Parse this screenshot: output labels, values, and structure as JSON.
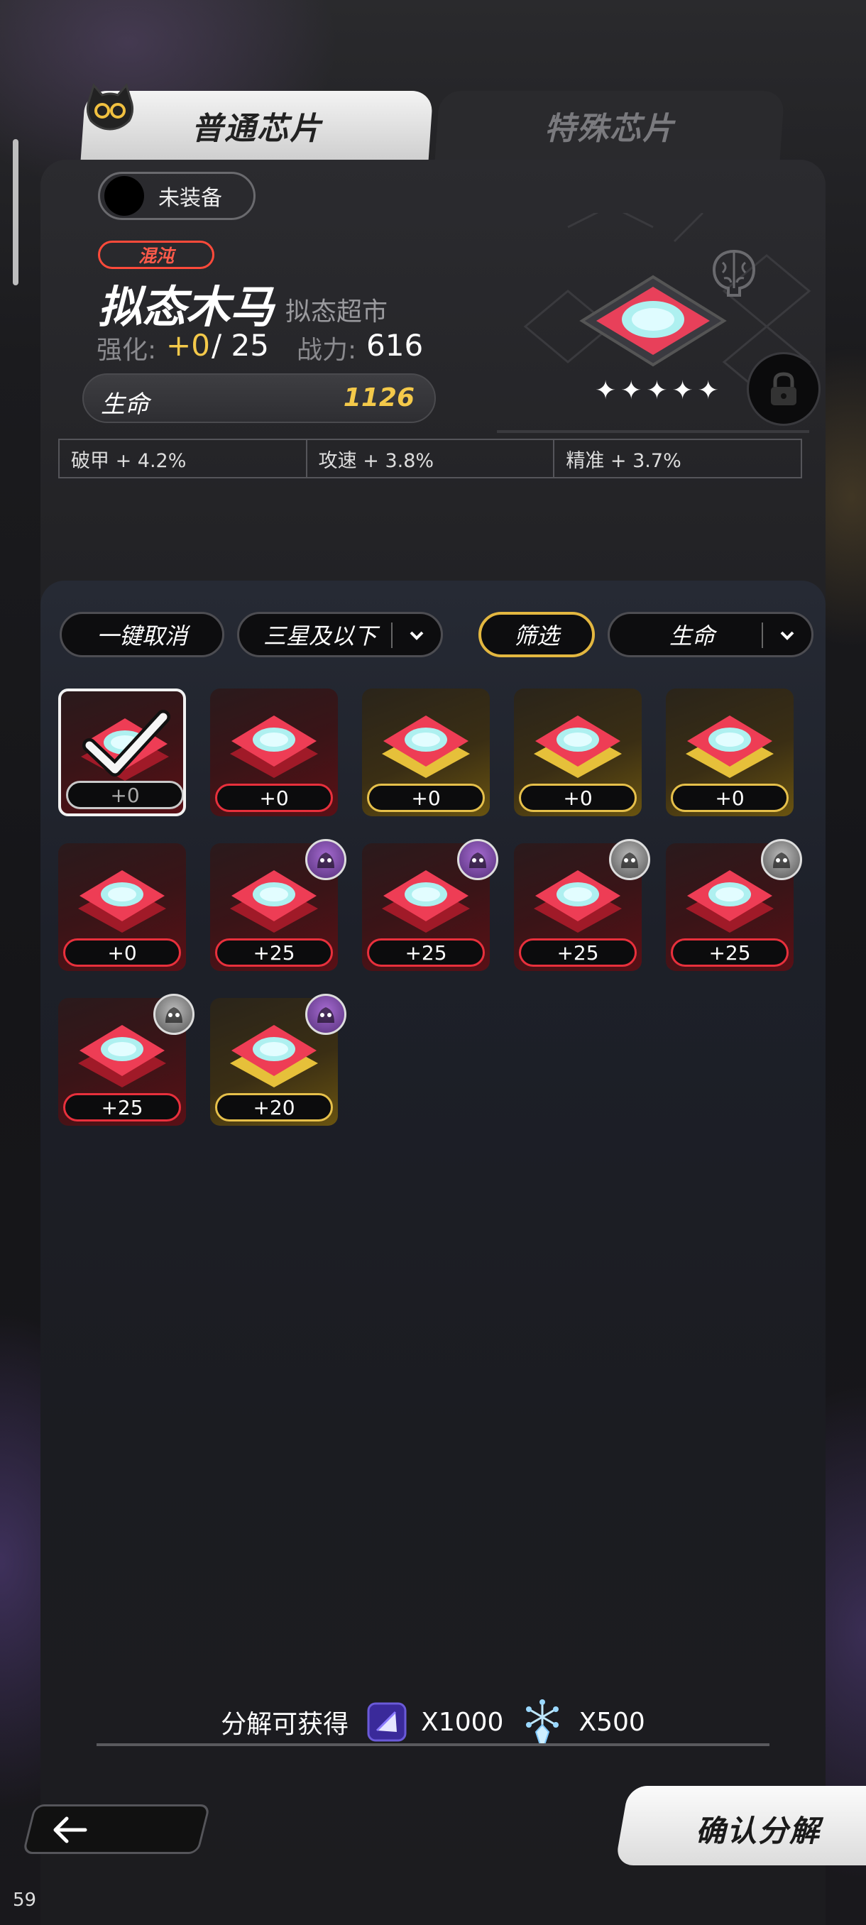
{
  "tabs": {
    "normal": "普通芯片",
    "special": "特殊芯片"
  },
  "equip_status": "未装备",
  "chip": {
    "tag": "混沌",
    "name": "拟态木马",
    "set": "拟态超市",
    "enhance_label": "强化:",
    "enhance_value": "+0",
    "enhance_max": "/ 25",
    "power_label": "战力:",
    "power_value": "616",
    "main_stat_label": "生命",
    "main_stat_value": "1126",
    "stars": "✦✦✦✦✦",
    "star_count": 5,
    "sub_stats": [
      "破甲 + 4.2%",
      "攻速 + 3.8%",
      "精准 + 3.7%"
    ]
  },
  "controls": {
    "cancel_all": "一键取消",
    "star_filter": "三星及以下",
    "filter": "筛选",
    "sort": "生命"
  },
  "chips": [
    {
      "level": "+0",
      "rarity": "red",
      "selected": true,
      "owner": null
    },
    {
      "level": "+0",
      "rarity": "red",
      "selected": false,
      "owner": null
    },
    {
      "level": "+0",
      "rarity": "gold",
      "selected": false,
      "owner": null
    },
    {
      "level": "+0",
      "rarity": "gold",
      "selected": false,
      "owner": null
    },
    {
      "level": "+0",
      "rarity": "gold",
      "selected": false,
      "owner": null
    },
    {
      "level": "+0",
      "rarity": "red",
      "selected": false,
      "owner": null
    },
    {
      "level": "+25",
      "rarity": "red",
      "selected": false,
      "owner": "purple"
    },
    {
      "level": "+25",
      "rarity": "red",
      "selected": false,
      "owner": "purple"
    },
    {
      "level": "+25",
      "rarity": "red",
      "selected": false,
      "owner": "gray"
    },
    {
      "level": "+25",
      "rarity": "red",
      "selected": false,
      "owner": "gray"
    },
    {
      "level": "+25",
      "rarity": "red",
      "selected": false,
      "owner": "gray"
    },
    {
      "level": "+20",
      "rarity": "gold",
      "selected": false,
      "owner": "purple"
    }
  ],
  "decompose": {
    "label": "分解可获得",
    "reward1_icon": "purple-gem-icon",
    "reward1_amount": "X1000",
    "reward2_icon": "crystal-snowflake-icon",
    "reward2_amount": "X500"
  },
  "confirm_button": "确认分解",
  "corner_number": "59",
  "colors": {
    "gold": "#f4c94a",
    "red": "#e8303c",
    "chaos": "#ff4a3a"
  }
}
